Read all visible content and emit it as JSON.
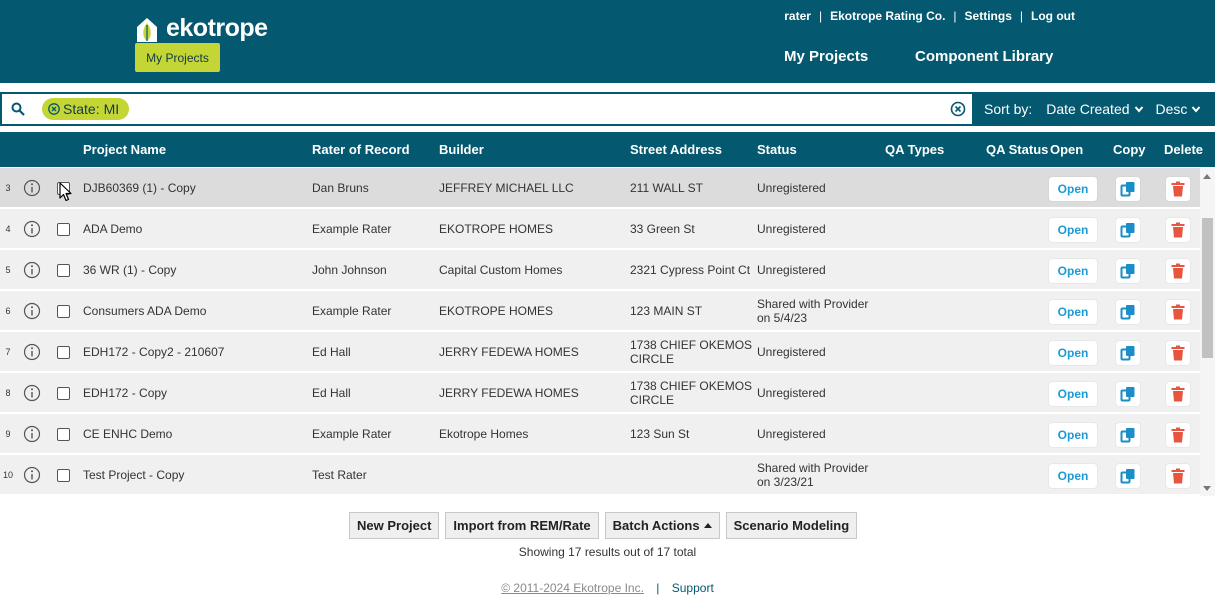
{
  "brand": {
    "name": "ekotrope",
    "pill": "My Projects"
  },
  "top_links": {
    "user": "rater",
    "company": "Ekotrope Rating Co.",
    "settings": "Settings",
    "logout": "Log out",
    "sep": "|"
  },
  "nav": {
    "projects": "My Projects",
    "library": "Component Library"
  },
  "search": {
    "chip_label": "State:",
    "chip_value": "MI"
  },
  "sort": {
    "label": "Sort by:",
    "field": "Date Created",
    "direction": "Desc"
  },
  "columns": {
    "name": "Project Name",
    "rater": "Rater of Record",
    "builder": "Builder",
    "address": "Street Address",
    "status": "Status",
    "qa_types": "QA Types",
    "qa_status": "QA Status",
    "open": "Open",
    "copy": "Copy",
    "delete": "Delete"
  },
  "rows": [
    {
      "num": "3",
      "name": "DJB60369 (1) - Copy",
      "rater": "Dan Bruns",
      "builder": "JEFFREY MICHAEL LLC",
      "address": "211 WALL ST",
      "status": "Unregistered",
      "open": "Open"
    },
    {
      "num": "4",
      "name": "ADA Demo",
      "rater": "Example Rater",
      "builder": "EKOTROPE HOMES",
      "address": "33 Green St",
      "status": "Unregistered",
      "open": "Open"
    },
    {
      "num": "5",
      "name": "36 WR (1) - Copy",
      "rater": "John Johnson",
      "builder": "Capital Custom Homes",
      "address": "2321 Cypress Point Ct",
      "status": "Unregistered",
      "open": "Open"
    },
    {
      "num": "6",
      "name": "Consumers ADA Demo",
      "rater": "Example Rater",
      "builder": "EKOTROPE HOMES",
      "address": "123 MAIN ST",
      "status": "Shared with Provider on 5/4/23",
      "open": "Open"
    },
    {
      "num": "7",
      "name": "EDH172 - Copy2 - 210607",
      "rater": "Ed Hall",
      "builder": "JERRY FEDEWA HOMES",
      "address": "1738 CHIEF OKEMOS CIRCLE",
      "status": "Unregistered",
      "open": "Open"
    },
    {
      "num": "8",
      "name": "EDH172 - Copy",
      "rater": "Ed Hall",
      "builder": "JERRY FEDEWA HOMES",
      "address": "1738 CHIEF OKEMOS CIRCLE",
      "status": "Unregistered",
      "open": "Open"
    },
    {
      "num": "9",
      "name": "CE ENHC Demo",
      "rater": "Example Rater",
      "builder": "Ekotrope Homes",
      "address": "123 Sun St",
      "status": "Unregistered",
      "open": "Open"
    },
    {
      "num": "10",
      "name": "Test Project - Copy",
      "rater": "Test Rater",
      "builder": "",
      "address": "",
      "status": "Shared with Provider on 3/23/21",
      "open": "Open"
    }
  ],
  "actions": {
    "new_project": "New Project",
    "import": "Import from REM/Rate",
    "batch": "Batch Actions",
    "scenario": "Scenario Modeling"
  },
  "results_text": "Showing 17 results out of 17 total",
  "footer": {
    "copyright": "© 2011-2024 Ekotrope Inc.",
    "sep": "|",
    "support": "Support"
  },
  "colors": {
    "header": "#04586f",
    "accent": "#c4d636",
    "open_text": "#1b9ad6",
    "copy_icon": "#1b8ec8",
    "delete_icon": "#e8553f"
  }
}
